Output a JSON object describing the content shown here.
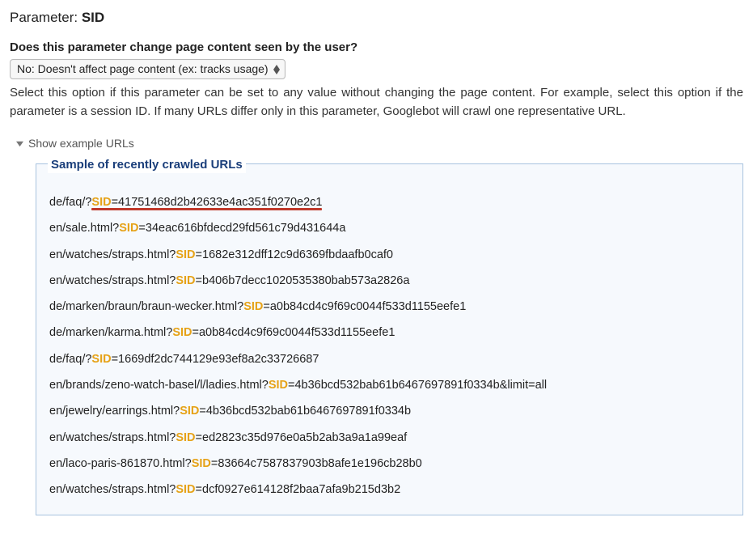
{
  "parameter": {
    "label": "Parameter:",
    "value": "SID"
  },
  "question": "Does this parameter change page content seen by the user?",
  "select": {
    "selected": "No: Doesn't affect page content (ex: tracks usage)"
  },
  "description": "Select this option if this parameter can be set to any value without changing the page content. For example, select this option if the parameter is a session ID. If many URLs differ only in this parameter, Googlebot will crawl one representative URL.",
  "expander_label": "Show example URLs",
  "sample_box": {
    "legend": "Sample of recently crawled URLs",
    "param_token": "SID",
    "urls": [
      {
        "prefix": "de/faq/?",
        "suffix": "=41751468d2b42633e4ac351f0270e2c1",
        "highlighted": true
      },
      {
        "prefix": "en/sale.html?",
        "suffix": "=34eac616bfdecd29fd561c79d431644a"
      },
      {
        "prefix": "en/watches/straps.html?",
        "suffix": "=1682e312dff12c9d6369fbdaafb0caf0"
      },
      {
        "prefix": "en/watches/straps.html?",
        "suffix": "=b406b7decc1020535380bab573a2826a"
      },
      {
        "prefix": "de/marken/braun/braun-wecker.html?",
        "suffix": "=a0b84cd4c9f69c0044f533d1155eefe1"
      },
      {
        "prefix": "de/marken/karma.html?",
        "suffix": "=a0b84cd4c9f69c0044f533d1155eefe1"
      },
      {
        "prefix": "de/faq/?",
        "suffix": "=1669df2dc744129e93ef8a2c33726687"
      },
      {
        "prefix": "en/brands/zeno-watch-basel/l/ladies.html?",
        "suffix": "=4b36bcd532bab61b6467697891f0334b&limit=all"
      },
      {
        "prefix": "en/jewelry/earrings.html?",
        "suffix": "=4b36bcd532bab61b6467697891f0334b"
      },
      {
        "prefix": "en/watches/straps.html?",
        "suffix": "=ed2823c35d976e0a5b2ab3a9a1a99eaf"
      },
      {
        "prefix": "en/laco-paris-861870.html?",
        "suffix": "=83664c7587837903b8afe1e196cb28b0"
      },
      {
        "prefix": "en/watches/straps.html?",
        "suffix": "=dcf0927e614128f2baa7afa9b215d3b2"
      }
    ]
  }
}
